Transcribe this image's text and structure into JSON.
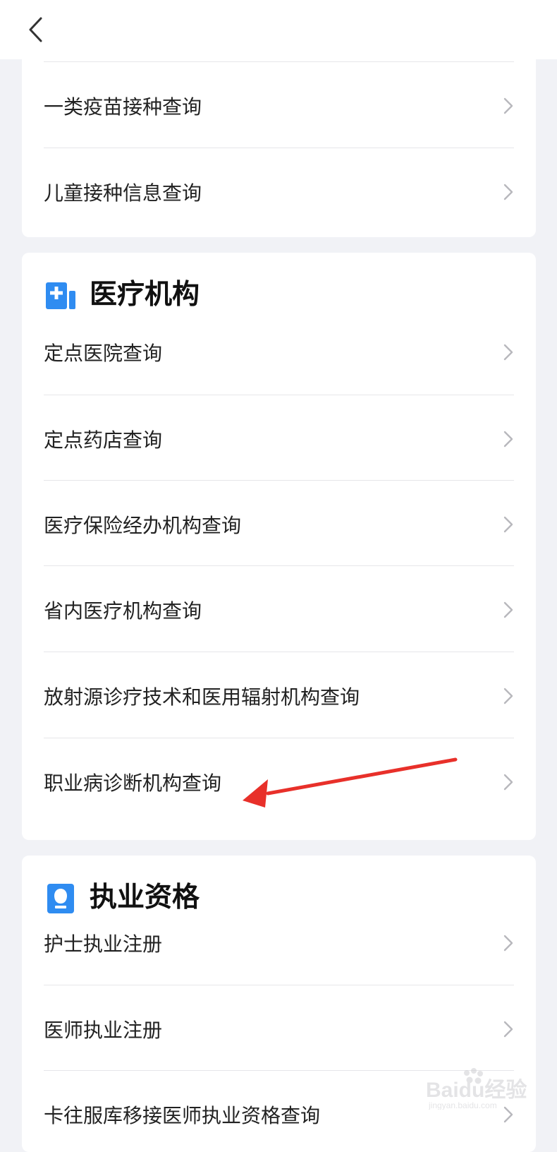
{
  "header": {
    "back_label": ""
  },
  "sections": [
    {
      "title": "",
      "items": [
        {
          "label": "一类疫苗接种查询"
        },
        {
          "label": "儿童接种信息查询"
        }
      ]
    },
    {
      "title": "医疗机构",
      "icon": "hospital-icon",
      "items": [
        {
          "label": "定点医院查询"
        },
        {
          "label": "定点药店查询"
        },
        {
          "label": "医疗保险经办机构查询"
        },
        {
          "label": "省内医疗机构查询"
        },
        {
          "label": "放射源诊疗技术和医用辐射机构查询"
        },
        {
          "label": "职业病诊断机构查询"
        }
      ]
    },
    {
      "title": "执业资格",
      "icon": "certificate-icon",
      "items": [
        {
          "label": "护士执业注册"
        },
        {
          "label": "医师执业注册"
        },
        {
          "label": "卡往服库移接医师执业资格查询"
        }
      ]
    }
  ],
  "annotation": {
    "arrow_color": "#e8302a",
    "target": "职业病诊断机构查询"
  },
  "watermark": {
    "brand": "Baidu经验",
    "url": "jingyan.baidu.com"
  },
  "colors": {
    "accent_blue": "#2f8cf1",
    "background": "#f1f2f6"
  }
}
